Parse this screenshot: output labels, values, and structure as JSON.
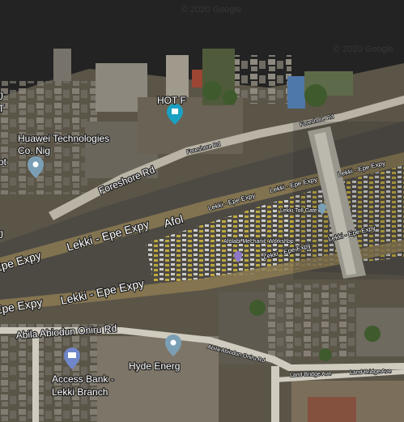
{
  "watermark": "© 2020 Google",
  "colors": {
    "water": "#232323",
    "land": "#5b5548",
    "expressway_band": "#8c7a52",
    "road_light": "#cfcbbf",
    "poi_place": "#7a9fb5",
    "poi_bank": "#6f86c9",
    "poi_shop": "#1aa1c2"
  },
  "labels": {
    "expressway": "Lekki - Epe Expy",
    "expressway_short": "Epe Expy",
    "foreshore_rd": "Foreshore Rd",
    "abila_rd": "Abila Abiodun Oniru Rd",
    "land_bridge_ave": "Land Bridge Ave",
    "afol_fragment": "Afol",
    "toll_gate": "Lekki Toll Gate",
    "mechanic": "Afolabi Mechanic Workshop"
  },
  "places": {
    "hot": {
      "name": "HOT F",
      "icon": "shopping-bag-icon"
    },
    "huawei": {
      "name": "Huawei Technologies Co. Nig",
      "name_line1": "Huawei Technologies",
      "name_line2": "Co. Nig",
      "icon": "location-pin-icon"
    },
    "hyde": {
      "name": "Hyde Energ",
      "icon": "location-pin-icon"
    },
    "access": {
      "name": "Access Bank - Lekki Branch",
      "name_line1": "Access Bank -",
      "name_line2": "Lekki Branch",
      "icon": "bank-icon"
    },
    "left_fragments": {
      "line1": "J",
      "line2": "T",
      "line3": "ot",
      "line4": "J"
    }
  }
}
